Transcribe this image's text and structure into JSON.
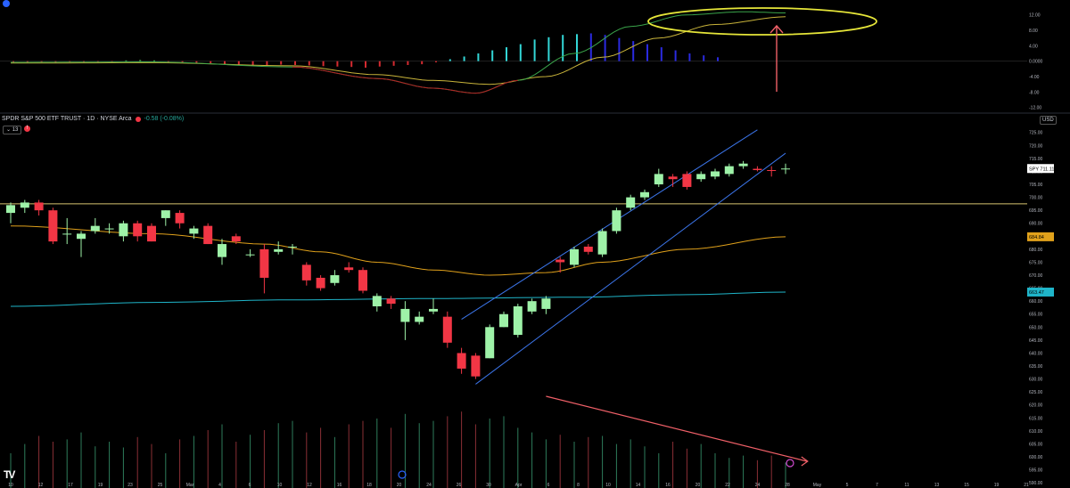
{
  "header": {
    "symbol": "SPDR S&P 500 ETF TRUST · 1D · NYSE Arca",
    "change": "-0.58 (-0.08%)",
    "interval_badge": "13",
    "currency": "USD"
  },
  "colors": {
    "up": "#9ef2a8",
    "down": "#f23645",
    "ema_short": "#e0a11b",
    "ma_long": "#1fb5c9",
    "channel": "#3b74e8",
    "hline": "#d6c470",
    "annotation": "#f06068",
    "ellipse": "#e6e639"
  },
  "x_axis_labels": [
    "10",
    "12",
    "17",
    "19",
    "23",
    "25",
    "Mar",
    "4",
    "6",
    "10",
    "12",
    "16",
    "18",
    "20",
    "24",
    "26",
    "30",
    "Apr",
    "6",
    "8",
    "10",
    "14",
    "16",
    "20",
    "22",
    "24",
    "28",
    "May",
    "5",
    "7",
    "11",
    "13",
    "15",
    "19",
    "21"
  ],
  "price_axis": {
    "labels": [
      "725.00",
      "720.00",
      "715.00",
      "710.00",
      "705.00",
      "700.00",
      "695.00",
      "690.00",
      "685.00",
      "680.00",
      "675.00",
      "670.00",
      "665.00",
      "660.00",
      "655.00",
      "650.00",
      "645.00",
      "640.00",
      "635.00",
      "630.00",
      "625.00",
      "620.00",
      "615.00",
      "610.00",
      "605.00",
      "600.00",
      "595.00",
      "590.00"
    ],
    "last_price_tag": "SPY 711.11",
    "ema_tag": "684.84",
    "ma_tag": "663.47"
  },
  "oscillator_axis": {
    "labels": [
      "12.00",
      "8.00",
      "4.00",
      "0.0000",
      "-4.00",
      "-8.00",
      "-12.00"
    ]
  },
  "chart_data": {
    "type": "candlestick",
    "title": "SPDR S&P 500 ETF TRUST · 1D · NYSE Arca",
    "y_range": [
      588,
      728
    ],
    "horizontal_level": 697.5,
    "candles": [
      {
        "o": 694,
        "h": 698,
        "l": 690,
        "c": 697
      },
      {
        "o": 696,
        "h": 699,
        "l": 694,
        "c": 698
      },
      {
        "o": 698,
        "h": 699,
        "l": 693,
        "c": 695
      },
      {
        "o": 695,
        "h": 696,
        "l": 682,
        "c": 683
      },
      {
        "o": 686,
        "h": 692,
        "l": 682,
        "c": 686
      },
      {
        "o": 684,
        "h": 687,
        "l": 677,
        "c": 686
      },
      {
        "o": 687,
        "h": 692,
        "l": 686,
        "c": 689
      },
      {
        "o": 688,
        "h": 690,
        "l": 686,
        "c": 688
      },
      {
        "o": 685,
        "h": 691,
        "l": 683,
        "c": 690
      },
      {
        "o": 690,
        "h": 691,
        "l": 683,
        "c": 685
      },
      {
        "o": 689,
        "h": 690,
        "l": 683,
        "c": 683
      },
      {
        "o": 692,
        "h": 695,
        "l": 689,
        "c": 695
      },
      {
        "o": 694,
        "h": 695,
        "l": 688,
        "c": 690
      },
      {
        "o": 686,
        "h": 689,
        "l": 684,
        "c": 688
      },
      {
        "o": 689,
        "h": 690,
        "l": 682,
        "c": 682
      },
      {
        "o": 677,
        "h": 684,
        "l": 674,
        "c": 682
      },
      {
        "o": 685,
        "h": 686,
        "l": 682,
        "c": 683
      },
      {
        "o": 678,
        "h": 680,
        "l": 677,
        "c": 678
      },
      {
        "o": 680,
        "h": 682,
        "l": 663,
        "c": 669
      },
      {
        "o": 679,
        "h": 683,
        "l": 678,
        "c": 680
      },
      {
        "o": 681,
        "h": 682,
        "l": 678,
        "c": 681
      },
      {
        "o": 674,
        "h": 675,
        "l": 666,
        "c": 668
      },
      {
        "o": 669,
        "h": 670,
        "l": 664,
        "c": 665
      },
      {
        "o": 667,
        "h": 672,
        "l": 666,
        "c": 670
      },
      {
        "o": 673,
        "h": 675,
        "l": 671,
        "c": 672
      },
      {
        "o": 672,
        "h": 673,
        "l": 663,
        "c": 664
      },
      {
        "o": 658,
        "h": 663,
        "l": 656,
        "c": 662
      },
      {
        "o": 661,
        "h": 662,
        "l": 657,
        "c": 659
      },
      {
        "o": 652,
        "h": 660,
        "l": 645,
        "c": 657
      },
      {
        "o": 652,
        "h": 656,
        "l": 651,
        "c": 654
      },
      {
        "o": 656,
        "h": 661,
        "l": 655,
        "c": 657
      },
      {
        "o": 654,
        "h": 656,
        "l": 642,
        "c": 644
      },
      {
        "o": 640,
        "h": 642,
        "l": 632,
        "c": 634
      },
      {
        "o": 639,
        "h": 640,
        "l": 630,
        "c": 631
      },
      {
        "o": 638,
        "h": 651,
        "l": 638,
        "c": 650
      },
      {
        "o": 650,
        "h": 656,
        "l": 650,
        "c": 655
      },
      {
        "o": 647,
        "h": 659,
        "l": 646,
        "c": 658
      },
      {
        "o": 656,
        "h": 661,
        "l": 655,
        "c": 660
      },
      {
        "o": 657,
        "h": 662,
        "l": 655,
        "c": 661
      },
      {
        "o": 676,
        "h": 677,
        "l": 671,
        "c": 675
      },
      {
        "o": 674,
        "h": 681,
        "l": 673,
        "c": 680
      },
      {
        "o": 681,
        "h": 682,
        "l": 678,
        "c": 679
      },
      {
        "o": 678,
        "h": 688,
        "l": 677,
        "c": 687
      },
      {
        "o": 687,
        "h": 696,
        "l": 686,
        "c": 695
      },
      {
        "o": 696,
        "h": 701,
        "l": 695,
        "c": 700
      },
      {
        "o": 700,
        "h": 703,
        "l": 699,
        "c": 702
      },
      {
        "o": 705,
        "h": 711,
        "l": 704,
        "c": 709
      },
      {
        "o": 708,
        "h": 709,
        "l": 704,
        "c": 707
      },
      {
        "o": 709,
        "h": 710,
        "l": 703,
        "c": 704
      },
      {
        "o": 707,
        "h": 710,
        "l": 706,
        "c": 709
      },
      {
        "o": 708,
        "h": 711,
        "l": 707,
        "c": 710
      },
      {
        "o": 709,
        "h": 713,
        "l": 708,
        "c": 712
      },
      {
        "o": 712,
        "h": 714,
        "l": 711,
        "c": 713
      },
      {
        "o": 711,
        "h": 712,
        "l": 710,
        "c": 710.5
      },
      {
        "o": 710.5,
        "h": 712,
        "l": 708,
        "c": 710.2
      },
      {
        "o": 711,
        "h": 713,
        "l": 709,
        "c": 711.1
      }
    ],
    "ema_short": [
      [
        0,
        689
      ],
      [
        10,
        686
      ],
      [
        18,
        682
      ],
      [
        22,
        679
      ],
      [
        26,
        675
      ],
      [
        30,
        672
      ],
      [
        34,
        670
      ],
      [
        38,
        671
      ],
      [
        42,
        675
      ],
      [
        48,
        680
      ],
      [
        55,
        684.8
      ]
    ],
    "ma_long": [
      [
        0,
        658
      ],
      [
        10,
        659.5
      ],
      [
        20,
        660.5
      ],
      [
        30,
        661
      ],
      [
        40,
        661.5
      ],
      [
        48,
        662.5
      ],
      [
        55,
        663.5
      ]
    ],
    "channel_upper": [
      [
        32,
        653
      ],
      [
        53,
        726
      ]
    ],
    "channel_lower": [
      [
        33,
        628
      ],
      [
        55,
        717
      ]
    ],
    "volume": [
      30,
      38,
      45,
      40,
      42,
      48,
      36,
      40,
      35,
      44,
      38,
      30,
      42,
      45,
      50,
      55,
      40,
      46,
      50,
      56,
      58,
      48,
      52,
      44,
      55,
      58,
      60,
      52,
      64,
      56,
      58,
      62,
      66,
      55,
      60,
      62,
      52,
      48,
      42,
      46,
      40,
      44,
      45,
      38,
      42,
      36,
      30,
      40,
      34,
      38,
      30,
      26,
      28,
      24,
      28,
      22
    ],
    "volume_trendline": [
      [
        38,
        520
      ],
      [
        56,
        585
      ]
    ],
    "oscillator": {
      "y_range": [
        -13,
        14
      ],
      "histogram": [
        -0.2,
        -0.3,
        -0.2,
        -0.4,
        -0.3,
        -0.2,
        -0.2,
        -0.1,
        0.2,
        0.3,
        0.2,
        -0.2,
        -0.3,
        -0.5,
        -0.6,
        -0.8,
        -0.9,
        -1.0,
        -1.2,
        -0.9,
        -1.0,
        -1.1,
        -1.3,
        -1.4,
        -1.5,
        -1.7,
        -1.4,
        -1.2,
        -1.0,
        -0.8,
        -0.3,
        0.5,
        1.2,
        2.0,
        2.8,
        3.6,
        4.4,
        5.6,
        6.2,
        6.8,
        7.0,
        7.2,
        6.8,
        6.0,
        5.2,
        4.4,
        3.6,
        2.8,
        2.0,
        1.5,
        1.0
      ],
      "line_green": [
        [
          0,
          -0.3
        ],
        [
          10,
          -0.2
        ],
        [
          20,
          -1.5
        ],
        [
          26,
          -4.5
        ],
        [
          30,
          -7
        ],
        [
          33,
          -8.3
        ],
        [
          36,
          -5
        ],
        [
          40,
          2
        ],
        [
          44,
          9
        ],
        [
          48,
          12
        ],
        [
          52,
          12.8
        ],
        [
          55,
          12.5
        ]
      ],
      "line_yellow": [
        [
          0,
          -0.5
        ],
        [
          10,
          -0.4
        ],
        [
          20,
          -1.2
        ],
        [
          26,
          -3.5
        ],
        [
          30,
          -5
        ],
        [
          34,
          -6
        ],
        [
          38,
          -4
        ],
        [
          42,
          1
        ],
        [
          46,
          6
        ],
        [
          50,
          9.5
        ],
        [
          55,
          11.5
        ]
      ]
    }
  }
}
